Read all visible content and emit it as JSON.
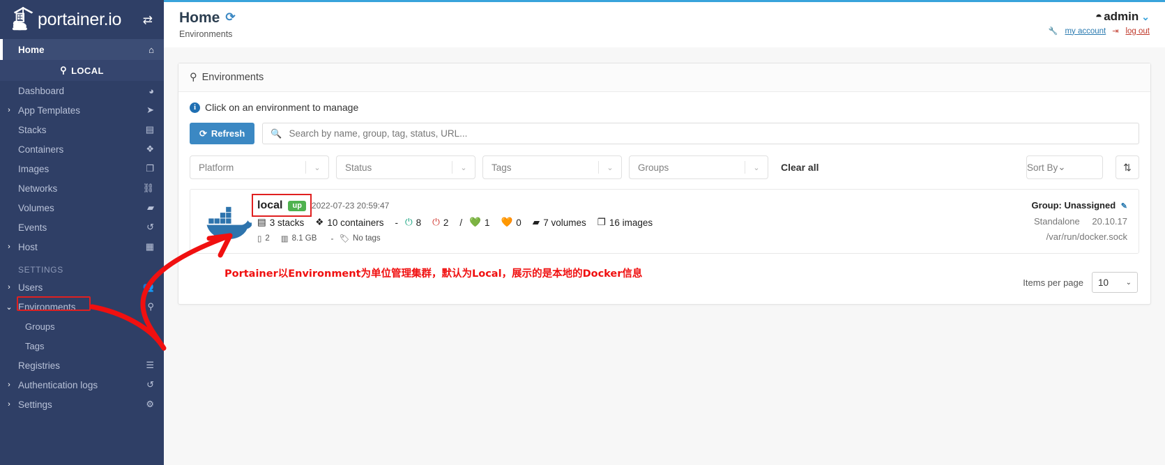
{
  "brand": {
    "name": "portainer.io",
    "logo_icon": "portainer-whale-crane-logo",
    "collapse_icon": "sidebar-toggle-icon"
  },
  "sidebar": {
    "home": {
      "label": "Home",
      "icon": "home-icon"
    },
    "local_band": {
      "label": "LOCAL",
      "icon": "plug-icon"
    },
    "env_items": [
      {
        "label": "Dashboard",
        "icon": "dashboard-icon",
        "caret": ""
      },
      {
        "label": "App Templates",
        "icon": "rocket-icon",
        "caret": "›"
      },
      {
        "label": "Stacks",
        "icon": "stacks-icon",
        "caret": ""
      },
      {
        "label": "Containers",
        "icon": "containers-icon",
        "caret": ""
      },
      {
        "label": "Images",
        "icon": "images-icon",
        "caret": ""
      },
      {
        "label": "Networks",
        "icon": "networks-icon",
        "caret": ""
      },
      {
        "label": "Volumes",
        "icon": "volumes-icon",
        "caret": ""
      },
      {
        "label": "Events",
        "icon": "events-history-icon",
        "caret": ""
      },
      {
        "label": "Host",
        "icon": "host-grid-icon",
        "caret": "›"
      }
    ],
    "settings_title": "SETTINGS",
    "settings_items": [
      {
        "label": "Users",
        "icon": "users-icon",
        "caret": "›",
        "sub": false,
        "highlighted": false
      },
      {
        "label": "Environments",
        "icon": "plug-icon",
        "caret": "⌄",
        "sub": false,
        "highlighted": true
      },
      {
        "label": "Groups",
        "icon": "",
        "caret": "",
        "sub": true,
        "highlighted": false
      },
      {
        "label": "Tags",
        "icon": "",
        "caret": "",
        "sub": true,
        "highlighted": false
      },
      {
        "label": "Registries",
        "icon": "registries-icon",
        "caret": "",
        "sub": false,
        "highlighted": false
      },
      {
        "label": "Authentication logs",
        "icon": "auth-logs-icon",
        "caret": "›",
        "sub": false,
        "highlighted": false
      },
      {
        "label": "Settings",
        "icon": "settings-gear-icon",
        "caret": "›",
        "sub": false,
        "highlighted": false
      }
    ]
  },
  "header": {
    "title": "Home",
    "title_icon": "refresh-icon",
    "subtitle": "Environments",
    "user": "admin",
    "user_icon": "user-circle-icon",
    "user_caret": "chevron-down-icon",
    "my_account": "my account",
    "my_account_icon": "wrench-icon",
    "log_out": "log out",
    "log_out_icon": "logout-icon"
  },
  "panel": {
    "title": "Environments",
    "title_icon": "plug-icon",
    "hint": "Click on an environment to manage",
    "hint_icon": "info-icon",
    "refresh_label": "Refresh",
    "refresh_icon": "refresh-icon",
    "search_placeholder": "Search by name, group, tag, status, URL...",
    "search_value": "",
    "search_icon": "search-icon",
    "filters": [
      {
        "label": "Platform",
        "name": "platform-filter"
      },
      {
        "label": "Status",
        "name": "status-filter"
      },
      {
        "label": "Tags",
        "name": "tags-filter"
      },
      {
        "label": "Groups",
        "name": "groups-filter"
      }
    ],
    "clear_all": "Clear all",
    "sort_by": "Sort By",
    "sort_dir_icon": "sort-direction-icon"
  },
  "environment": {
    "logo_icon": "docker-whale-icon",
    "name": "local",
    "status": "up",
    "timestamp": "2022-07-23 20:59:47",
    "stacks": {
      "count": "3 stacks",
      "icon": "stacks-icon"
    },
    "containers": {
      "count": "10 containers",
      "icon": "containers-icon"
    },
    "dash": "-",
    "running": {
      "value": "8",
      "icon": "power-on-icon",
      "color": "#14a37f"
    },
    "stopped": {
      "value": "2",
      "icon": "power-off-icon",
      "color": "#d0342c"
    },
    "slash": "/",
    "healthy": {
      "value": "1",
      "icon": "heart-healthy-icon",
      "color": "#27ae60"
    },
    "unhealthy": {
      "value": "0",
      "icon": "heart-unhealthy-icon",
      "color": "#e8a33d"
    },
    "volumes": {
      "count": "7 volumes",
      "icon": "volumes-icon"
    },
    "images": {
      "count": "16 images",
      "icon": "images-icon"
    },
    "cpu": {
      "value": "2",
      "icon": "cpu-icon"
    },
    "memory": {
      "value": "8.1 GB",
      "icon": "memory-icon"
    },
    "sub_dash": "-",
    "tags": {
      "label": "No tags",
      "icon": "tag-icon"
    },
    "group": "Group: Unassigned",
    "group_edit_icon": "pencil-edit-icon",
    "type": "Standalone",
    "version": "20.10.17",
    "socket": "/var/run/docker.sock"
  },
  "pager": {
    "label": "Items per page",
    "value": "10",
    "caret_icon": "chevron-down-icon"
  },
  "annotation": {
    "text": "Portainer以Environment为单位管理集群，默认为Local，展示的是本地的Docker信息",
    "color": "#f01010",
    "arrow_name": "red-annotation-arrow"
  },
  "colors": {
    "sidebar_bg": "#2f3f66",
    "accent_blue": "#38a3db",
    "primary_button": "#3b88c3",
    "status_up": "#4fb24f",
    "annotation_red": "#e02020"
  }
}
